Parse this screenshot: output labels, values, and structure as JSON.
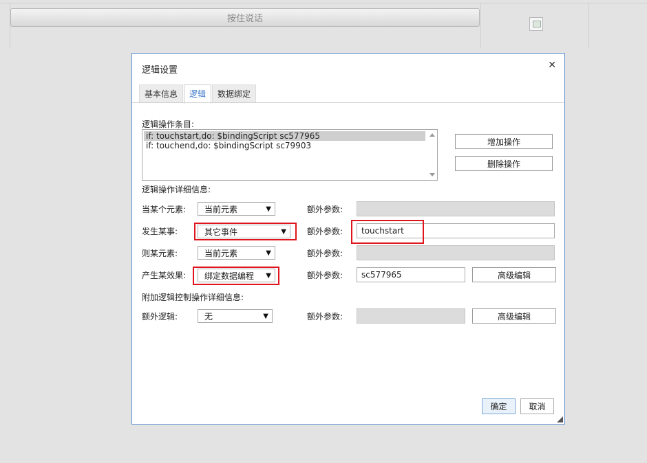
{
  "background": {
    "talk_button_label": "按住说话"
  },
  "dialog": {
    "title": "逻辑设置",
    "close_glyph": "✕",
    "tabs": [
      {
        "label": "基本信息",
        "active": false
      },
      {
        "label": "逻辑",
        "active": true
      },
      {
        "label": "数据绑定",
        "active": false
      }
    ],
    "entries_label": "逻辑操作条目:",
    "entries": [
      "if: touchstart,do: $bindingScript sc577965",
      "if: touchend,do: $bindingScript sc79903"
    ],
    "add_button": "增加操作",
    "delete_button": "删除操作",
    "detail_label": "逻辑操作详细信息:",
    "rows": {
      "element": {
        "label": "当某个元素:",
        "select": "当前元素",
        "param_label": "额外参数:",
        "param_value": ""
      },
      "event": {
        "label": "发生某事:",
        "select": "其它事件",
        "param_label": "额外参数:",
        "param_value": "touchstart"
      },
      "target": {
        "label": "则某元素:",
        "select": "当前元素",
        "param_label": "额外参数:",
        "param_value": ""
      },
      "effect": {
        "label": "产生某效果:",
        "select": "绑定数据编程",
        "param_label": "额外参数:",
        "param_value": "sc577965",
        "button": "高级编辑"
      }
    },
    "extra_label": "附加逻辑控制操作详细信息:",
    "extra_row": {
      "label": "额外逻辑:",
      "select": "无",
      "param_label": "额外参数:",
      "param_value": "",
      "button": "高级编辑"
    },
    "ok_button": "确定",
    "cancel_button": "取消",
    "accent_color": "#5b8fd1",
    "highlight_color": "#e0141c"
  }
}
